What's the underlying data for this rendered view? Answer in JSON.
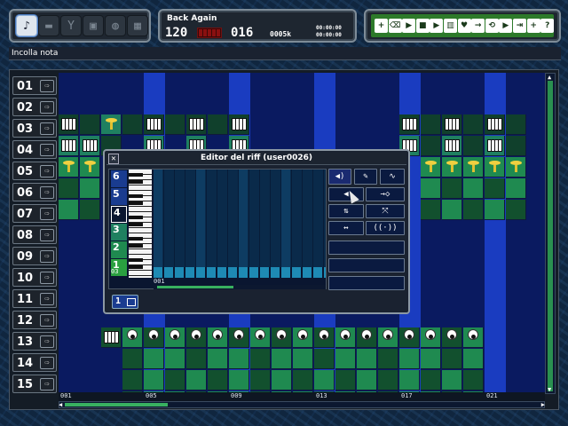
{
  "song": {
    "title": "Back Again",
    "tempo": "120",
    "pattern": "016",
    "size": "0005k",
    "time_top": "00:00:00",
    "time_bottom": "00:00:00"
  },
  "status": {
    "text": "Incolla nota"
  },
  "tools": [
    {
      "icon": "ear-icon",
      "glyph": "♪",
      "active": true
    },
    {
      "icon": "rectangle-icon",
      "glyph": "▬",
      "active": false
    },
    {
      "icon": "funnel-icon",
      "glyph": "Y",
      "active": false
    },
    {
      "icon": "disk-icon",
      "glyph": "▣",
      "active": false
    },
    {
      "icon": "globe-icon",
      "glyph": "◍",
      "active": false
    },
    {
      "icon": "grid-icon",
      "glyph": "▦",
      "active": false
    }
  ],
  "actions": [
    {
      "icon": "new-icon",
      "glyph": "+"
    },
    {
      "icon": "trash-icon",
      "glyph": "⌫"
    },
    {
      "icon": "play-icon",
      "glyph": "▶"
    },
    {
      "icon": "stop-icon",
      "glyph": "■"
    },
    {
      "icon": "play-pattern-icon",
      "glyph": "▶"
    },
    {
      "icon": "piano-icon",
      "glyph": "▥"
    },
    {
      "icon": "heart-icon",
      "glyph": "♥"
    },
    {
      "icon": "arrow-right-icon",
      "glyph": "→"
    },
    {
      "icon": "loop-icon",
      "glyph": "⟲"
    },
    {
      "icon": "forward-icon",
      "glyph": "▶"
    },
    {
      "icon": "next-icon",
      "glyph": "⇥"
    },
    {
      "icon": "plus-icon",
      "glyph": "+"
    },
    {
      "icon": "help-icon",
      "glyph": "?"
    }
  ],
  "tracks": [
    {
      "label": "01"
    },
    {
      "label": "02"
    },
    {
      "label": "03"
    },
    {
      "label": "04"
    },
    {
      "label": "05"
    },
    {
      "label": "06"
    },
    {
      "label": "07"
    },
    {
      "label": "08"
    },
    {
      "label": "09"
    },
    {
      "label": "10"
    },
    {
      "label": "11"
    },
    {
      "label": "12"
    },
    {
      "label": "13"
    },
    {
      "label": "14"
    },
    {
      "label": "15"
    }
  ],
  "ruler": [
    "001",
    "005",
    "009",
    "013",
    "017",
    "021"
  ],
  "riff_editor": {
    "title": "Editor del riff (user0026)",
    "octaves": [
      "6",
      "5",
      "4",
      "3",
      "2",
      "1"
    ],
    "current_octave": "4",
    "velocity_label": "03",
    "ruler": [
      "001",
      "",
      "",
      "",
      ""
    ],
    "footer_number": "1"
  },
  "colors": {
    "accent": "#2d7a2a",
    "track_blue": "#1a3cc0",
    "track_navy": "#0a1a60",
    "green_cell": "#1f8a50"
  }
}
